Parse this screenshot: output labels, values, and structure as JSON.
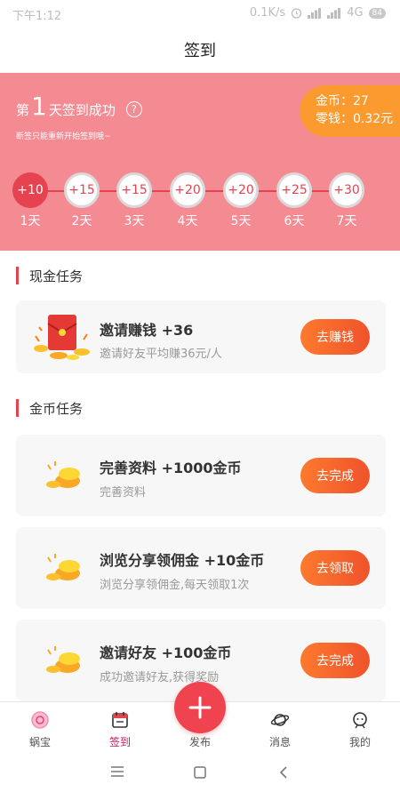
{
  "status": {
    "time": "下午1:12",
    "speed": "0.1K/s",
    "network": "4G",
    "battery": "84"
  },
  "header": {
    "title": "签到"
  },
  "banner": {
    "streak_prefix": "第",
    "streak_days": "1",
    "streak_suffix": "天签到成功",
    "hint": "断签只能重新开始签到哦~",
    "coins_label": "金币：27",
    "change_label": "零钱：0.32元",
    "days": [
      {
        "bonus": "+10",
        "label": "1天",
        "done": true
      },
      {
        "bonus": "+15",
        "label": "2天",
        "done": false
      },
      {
        "bonus": "+15",
        "label": "3天",
        "done": false
      },
      {
        "bonus": "+20",
        "label": "4天",
        "done": false
      },
      {
        "bonus": "+20",
        "label": "5天",
        "done": false
      },
      {
        "bonus": "+25",
        "label": "6天",
        "done": false
      },
      {
        "bonus": "+30",
        "label": "7天",
        "done": false
      }
    ]
  },
  "cash_tasks": {
    "heading": "现金任务",
    "items": [
      {
        "title": "邀请赚钱 +36",
        "subtitle": "邀请好友平均赚36元/人",
        "button": "去赚钱"
      }
    ]
  },
  "coin_tasks": {
    "heading": "金币任务",
    "items": [
      {
        "title": "完善资料 +1000金币",
        "subtitle": "完善资料",
        "button": "去完成"
      },
      {
        "title": "浏览分享领佣金 +10金币",
        "subtitle": "浏览分享领佣金,每天领取1次",
        "button": "去领取"
      },
      {
        "title": "邀请好友 +100金币",
        "subtitle": "成功邀请好友,获得奖励",
        "button": "去完成"
      }
    ]
  },
  "tabbar": {
    "items": [
      {
        "label": "蜗宝",
        "icon": "snail-icon"
      },
      {
        "label": "签到",
        "icon": "calendar-icon",
        "active": true
      },
      {
        "label": "发布",
        "icon": "plus-icon"
      },
      {
        "label": "消息",
        "icon": "planet-icon"
      },
      {
        "label": "我的",
        "icon": "profile-icon"
      }
    ]
  },
  "colors": {
    "banner": "#f48b93",
    "accent": "#e5434f",
    "coin_badge": "#fb9a2e",
    "button": "#f0522b"
  }
}
